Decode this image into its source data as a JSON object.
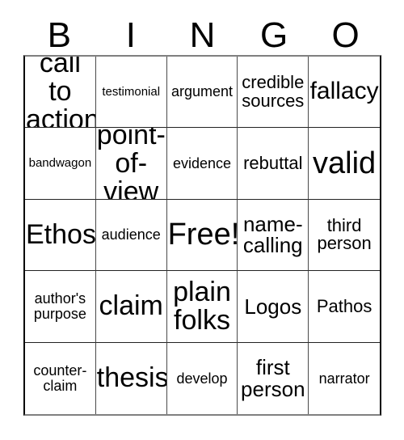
{
  "card": {
    "title": "BINGO",
    "headers": [
      "B",
      "I",
      "N",
      "G",
      "O"
    ],
    "free_space_label": "Free!",
    "colors": {
      "text": "#000000",
      "background": "#ffffff",
      "grid_line": "#333333"
    },
    "cells": [
      {
        "text": "call to\naction",
        "size": "fs-xxl"
      },
      {
        "text": "testimonial",
        "size": "fs-xs"
      },
      {
        "text": "argument",
        "size": "fs-sm"
      },
      {
        "text": "credible\nsources",
        "size": "fs-md"
      },
      {
        "text": "fallacy",
        "size": "fs-xl"
      },
      {
        "text": "bandwagon",
        "size": "fs-xs"
      },
      {
        "text": "point-\nof-view",
        "size": "fs-xxl"
      },
      {
        "text": "evidence",
        "size": "fs-sm"
      },
      {
        "text": "rebuttal",
        "size": "fs-md"
      },
      {
        "text": "valid",
        "size": "fs-huge"
      },
      {
        "text": "Ethos",
        "size": "fs-xxl"
      },
      {
        "text": "audience",
        "size": "fs-sm"
      },
      {
        "text": "Free!",
        "size": "fs-huge"
      },
      {
        "text": "name-\ncalling",
        "size": "fs-lg"
      },
      {
        "text": "third\nperson",
        "size": "fs-md"
      },
      {
        "text": "author's\npurpose",
        "size": "fs-sm"
      },
      {
        "text": "claim",
        "size": "fs-xxl"
      },
      {
        "text": "plain\nfolks",
        "size": "fs-xxl"
      },
      {
        "text": "Logos",
        "size": "fs-lg"
      },
      {
        "text": "Pathos",
        "size": "fs-md"
      },
      {
        "text": "counter-\nclaim",
        "size": "fs-sm"
      },
      {
        "text": "thesis",
        "size": "fs-xxl"
      },
      {
        "text": "develop",
        "size": "fs-sm"
      },
      {
        "text": "first\nperson",
        "size": "fs-lg"
      },
      {
        "text": "narrator",
        "size": "fs-sm"
      }
    ]
  }
}
